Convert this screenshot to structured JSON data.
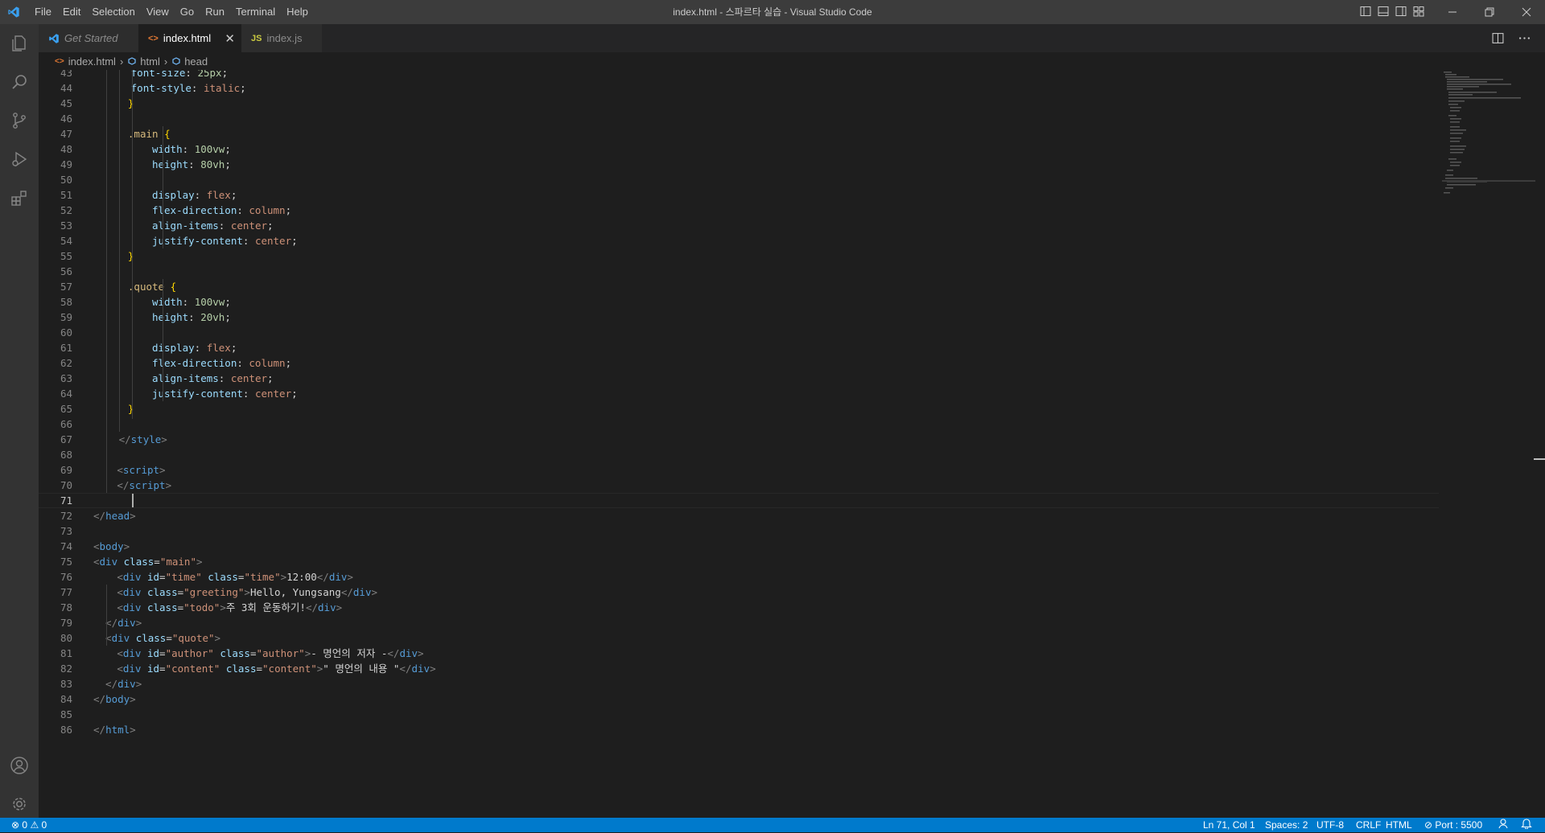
{
  "menu": [
    "File",
    "Edit",
    "Selection",
    "View",
    "Go",
    "Run",
    "Terminal",
    "Help"
  ],
  "window_title": "index.html - 스파르타 실습 - Visual Studio Code",
  "tabs": [
    {
      "label": "Get Started",
      "icon": "vscode-icon"
    },
    {
      "label": "index.html",
      "icon": "html-icon",
      "icon_glyph": "<>",
      "active": true
    },
    {
      "label": "index.js",
      "icon": "js-icon",
      "icon_glyph": "JS"
    }
  ],
  "breadcrumb": [
    "index.html",
    "html",
    "head"
  ],
  "editor": {
    "cursor_line": 71,
    "lines": [
      {
        "n": "43",
        "indent": 6
      },
      {
        "n": "44",
        "indent": 6
      },
      {
        "n": "45",
        "indent": 5
      },
      {
        "n": "46"
      },
      {
        "n": "47",
        "indent": 5
      },
      {
        "n": "48",
        "indent": 9
      },
      {
        "n": "49",
        "indent": 9
      },
      {
        "n": "50"
      },
      {
        "n": "51",
        "indent": 9
      },
      {
        "n": "52",
        "indent": 9
      },
      {
        "n": "53",
        "indent": 9
      },
      {
        "n": "54",
        "indent": 9
      },
      {
        "n": "55",
        "indent": 5
      },
      {
        "n": "56"
      },
      {
        "n": "57",
        "indent": 5
      },
      {
        "n": "58",
        "indent": 9
      },
      {
        "n": "59",
        "indent": 9
      },
      {
        "n": "60"
      },
      {
        "n": "61",
        "indent": 9
      },
      {
        "n": "62",
        "indent": 9
      },
      {
        "n": "63",
        "indent": 9
      },
      {
        "n": "64",
        "indent": 9
      },
      {
        "n": "65",
        "indent": 5
      },
      {
        "n": "66"
      },
      {
        "n": "67",
        "indent": 4
      },
      {
        "n": "68"
      },
      {
        "n": "69",
        "indent": 4
      },
      {
        "n": "70",
        "indent": 4
      },
      {
        "n": "71"
      },
      {
        "n": "72"
      },
      {
        "n": "73"
      },
      {
        "n": "74"
      },
      {
        "n": "75"
      },
      {
        "n": "76",
        "indent": 4
      },
      {
        "n": "77",
        "indent": 4
      },
      {
        "n": "78",
        "indent": 4
      },
      {
        "n": "79",
        "indent": 2
      },
      {
        "n": "80",
        "indent": 2
      },
      {
        "n": "81",
        "indent": 4
      },
      {
        "n": "82",
        "indent": 4
      },
      {
        "n": "83",
        "indent": 2
      },
      {
        "n": "84"
      },
      {
        "n": "85"
      },
      {
        "n": "86"
      }
    ],
    "text": {
      "l43_prop": "font-size",
      "l43_val": "25px",
      "l44_prop": "font-style",
      "l44_val": "italic",
      "brace_open": "{",
      "brace_close": "}",
      "l47_sel": ".main",
      "width": "width",
      "height": "height",
      "display": "display",
      "flex_direction": "flex-direction",
      "align_items": "align-items",
      "justify_content": "justify-content",
      "l48_val": "100vw",
      "l49_val": "80vh",
      "flex": "flex",
      "column": "column",
      "center": "center",
      "l57_sel": ".quote",
      "l58_val": "100vw",
      "l59_val": "20vh",
      "style_tag": "style",
      "script_tag": "script",
      "head_tag": "head",
      "body_tag": "body",
      "html_tag": "html",
      "div_tag": "div",
      "class_attr": "class",
      "id_attr": "id",
      "main_str": "\"main\"",
      "time_str": "\"time\"",
      "greeting_str": "\"greeting\"",
      "todo_str": "\"todo\"",
      "quote_str": "\"quote\"",
      "author_str": "\"author\"",
      "content_str": "\"content\"",
      "time_text": "12:00",
      "greeting_text": "Hello, Yungsang",
      "todo_text": "주 3회 운동하기!",
      "author_text": "- 명언의 저자 -",
      "content_text": "\" 명언의 내용 \""
    }
  },
  "status": {
    "errors": "0",
    "warnings": "0",
    "position": "Ln 71, Col 1",
    "spaces": "Spaces: 2",
    "encoding": "UTF-8",
    "eol": "CRLF",
    "language": "HTML",
    "port": "Port : 5500"
  },
  "colors": {
    "accent": "#007acc",
    "titlebar": "#3c3c3c",
    "activitybar": "#333333",
    "editor_bg": "#1e1e1e"
  }
}
